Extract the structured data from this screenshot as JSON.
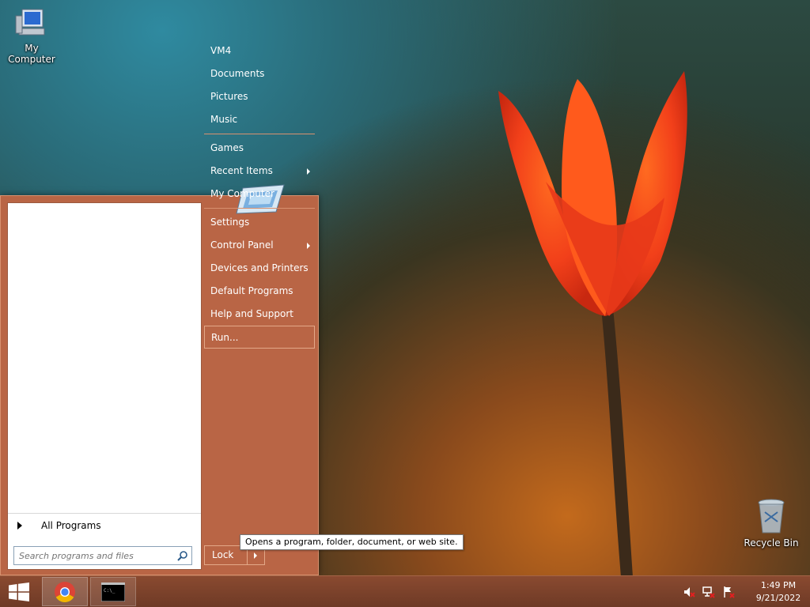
{
  "desktop": {
    "icons": [
      {
        "label": "My Computer"
      },
      {
        "label": "Recycle Bin"
      }
    ]
  },
  "start_menu": {
    "left": {
      "all_programs": "All Programs",
      "search_placeholder": "Search programs and files"
    },
    "right": {
      "items": [
        {
          "label": "VM4"
        },
        {
          "label": "Documents"
        },
        {
          "label": "Pictures"
        },
        {
          "label": "Music"
        },
        {
          "label": "Games"
        },
        {
          "label": "Recent Items",
          "submenu": true
        },
        {
          "label": "My Computer"
        },
        {
          "label": "Settings"
        },
        {
          "label": "Control Panel",
          "submenu": true
        },
        {
          "label": "Devices and Printers"
        },
        {
          "label": "Default Programs"
        },
        {
          "label": "Help and Support"
        },
        {
          "label": "Run..."
        }
      ],
      "lock": "Lock"
    },
    "tooltip": "Opens a program, folder, document, or web site."
  },
  "taskbar": {
    "start_icon": "windows-logo-icon",
    "buttons": [
      {
        "icon": "chrome-icon"
      },
      {
        "icon": "command-prompt-icon"
      }
    ],
    "tray": {
      "icons": [
        "volume-muted-icon",
        "network-icon",
        "action-center-icon"
      ],
      "time": "1:49 PM",
      "date": "9/21/2022"
    }
  },
  "colors": {
    "start_menu_bg": "#b96545",
    "taskbar_bg": "#7a4029"
  }
}
